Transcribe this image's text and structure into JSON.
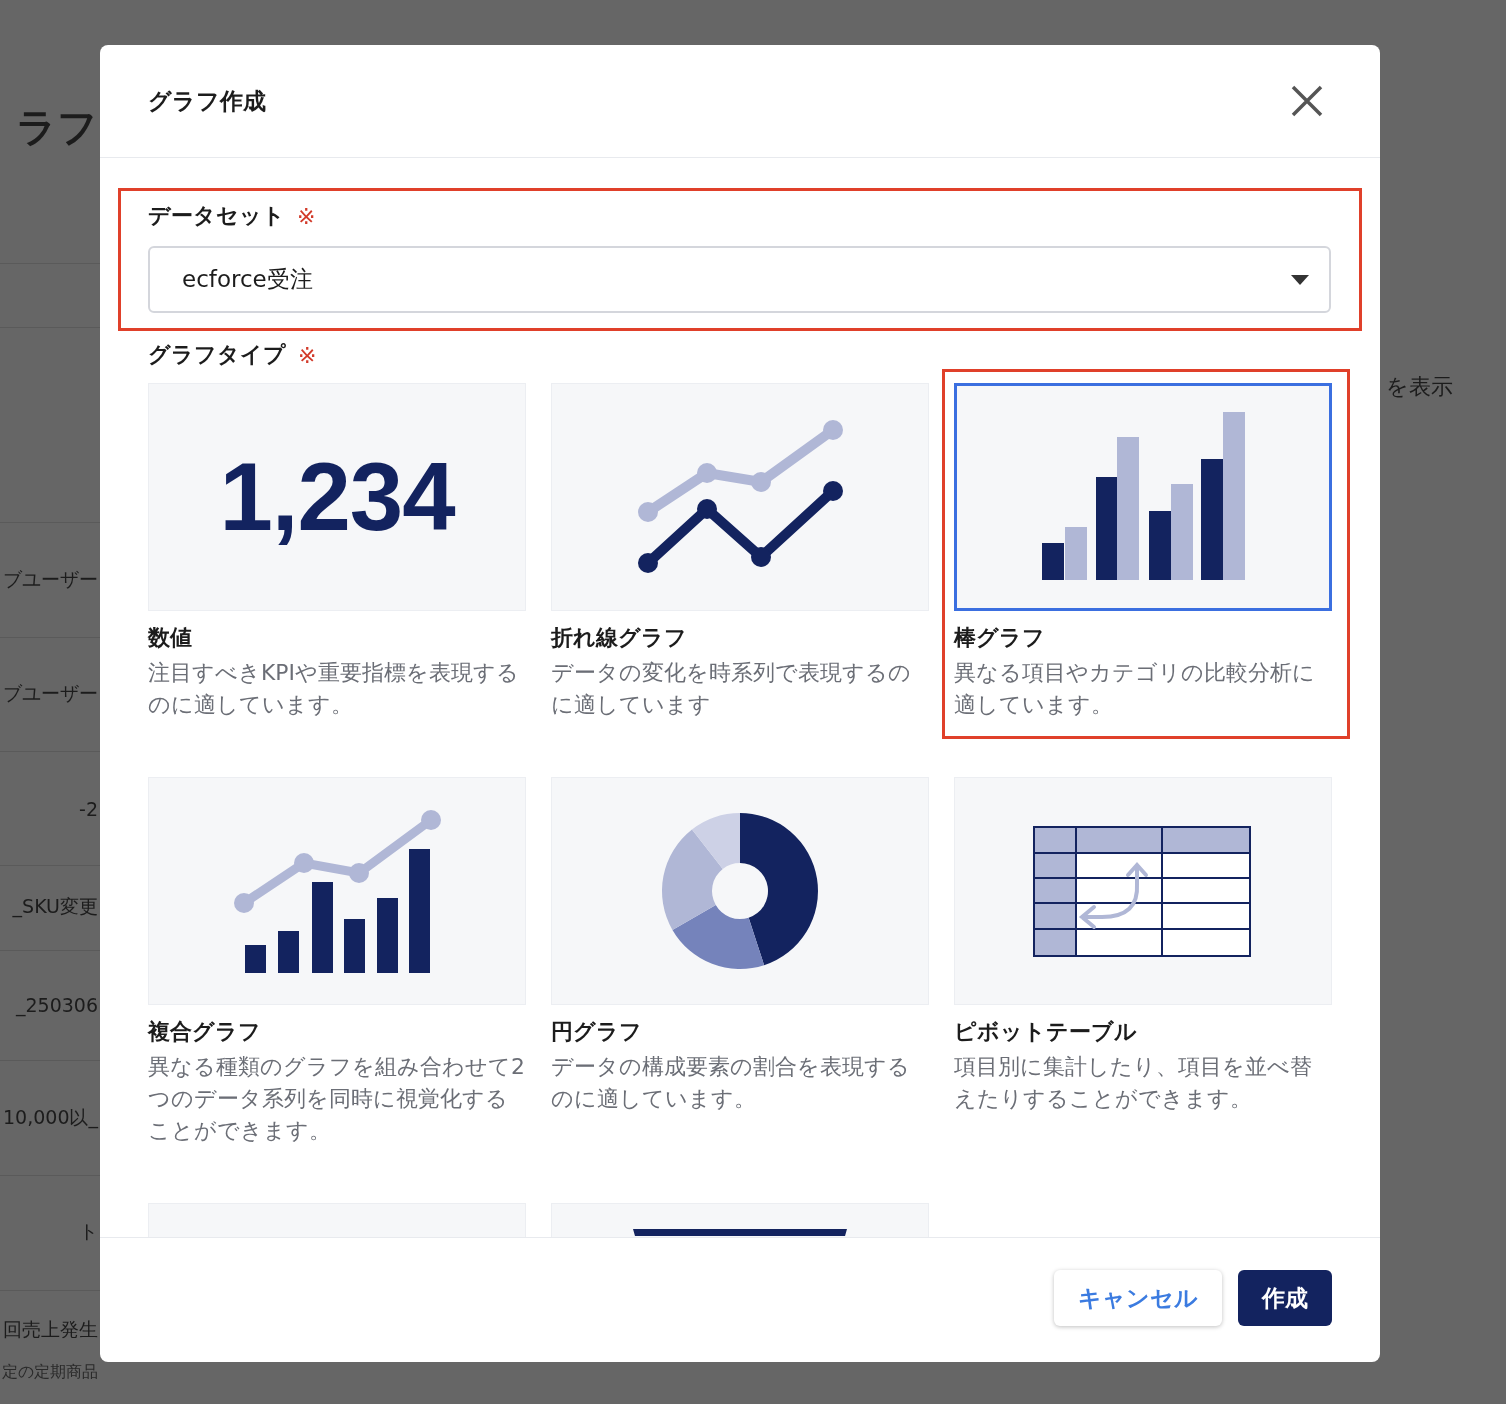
{
  "background_page": {
    "title": "ラフ",
    "side_note": "を表示",
    "rows": [
      "ブユーザー",
      "ブユーザー",
      "-2",
      "_SKU変更",
      "_250306",
      "10,000以_",
      "ト",
      "回売上発生"
    ],
    "footnote": "定の定期商品"
  },
  "dialog": {
    "title": "グラフ作成",
    "dataset": {
      "label": "データセット",
      "required_mark": "※",
      "value": "ecforce受注",
      "highlighted": true
    },
    "graph_type": {
      "label": "グラフタイプ",
      "required_mark": "※",
      "options": [
        {
          "kind": "number",
          "figure": "1,234",
          "title": "数値",
          "description": "注目すべきKPIや重要指標を表現するのに適しています。",
          "selected": false,
          "highlighted": false
        },
        {
          "kind": "line",
          "title": "折れ線グラフ",
          "description": "データの変化を時系列で表現するのに適しています",
          "selected": false,
          "highlighted": false
        },
        {
          "kind": "bar",
          "title": "棒グラフ",
          "description": "異なる項目やカテゴリの比較分析に適しています。",
          "selected": true,
          "highlighted": true
        },
        {
          "kind": "combo",
          "title": "複合グラフ",
          "description": "異なる種類のグラフを組み合わせて2つのデータ系列を同時に視覚化することができます。",
          "selected": false,
          "highlighted": false
        },
        {
          "kind": "pie",
          "title": "円グラフ",
          "description": "データの構成要素の割合を表現するのに適しています。",
          "selected": false,
          "highlighted": false
        },
        {
          "kind": "pivot",
          "title": "ピボットテーブル",
          "description": "項目別に集計したり、項目を並べ替えたりすることができます。",
          "selected": false,
          "highlighted": false
        },
        {
          "kind": "partial-blank",
          "selected": false,
          "highlighted": false
        },
        {
          "kind": "partial-bar",
          "selected": false,
          "highlighted": false
        }
      ]
    },
    "buttons": [
      {
        "kind": "secondary",
        "label": "キャンセル"
      },
      {
        "kind": "primary",
        "label": "作成"
      }
    ]
  }
}
